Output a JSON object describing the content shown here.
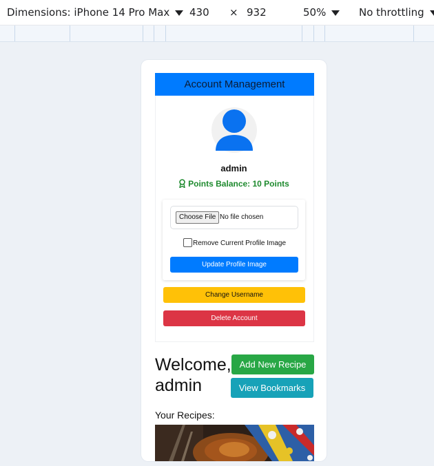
{
  "devtools": {
    "dimensions_label": "Dimensions: iPhone 14 Pro Max",
    "width": "430",
    "times": "×",
    "height": "932",
    "zoom": "50%",
    "throttling": "No throttling"
  },
  "account": {
    "header": "Account Management",
    "username": "admin",
    "points_label": "Points Balance: 10 Points",
    "file_button": "Choose File",
    "file_status": "No file chosen",
    "remove_label": "Remove Current Profile Image",
    "remove_checked": false,
    "update_button": "Update Profile Image",
    "change_username_button": "Change Username",
    "delete_button": "Delete Account"
  },
  "welcome": {
    "line1": "Welcome,",
    "line2": "admin",
    "add_button": "Add New Recipe",
    "bookmarks_button": "View Bookmarks",
    "recipes_title": "Your Recipes:"
  },
  "colors": {
    "primary": "#007bff",
    "success": "#28a745",
    "warning": "#ffc107",
    "danger": "#dc3545",
    "info": "#17a2b8",
    "points_green": "#1e8a2e"
  },
  "icons": [
    "caret-down-icon",
    "user-avatar-icon",
    "award-icon"
  ]
}
